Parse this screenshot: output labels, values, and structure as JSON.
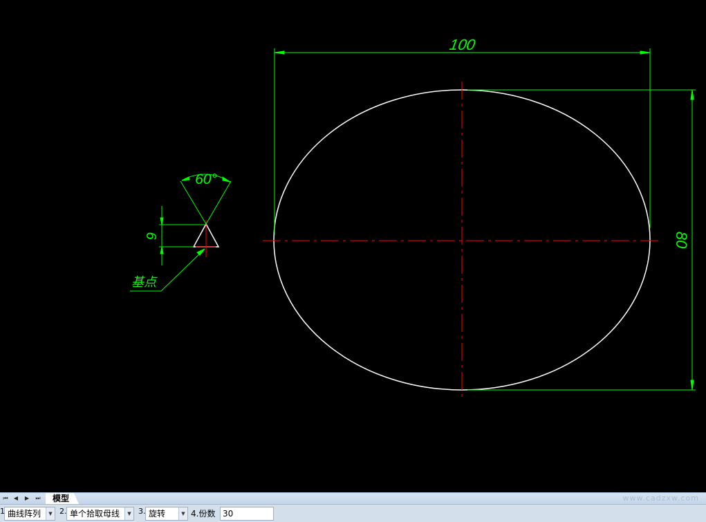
{
  "drawing": {
    "dim_width": "100",
    "dim_height": "80",
    "dim_angle": "60°",
    "dim_small": "6",
    "base_point_label": "基点",
    "colors": {
      "geometry": "#ffffff",
      "dimension": "#00ff00",
      "centerline": "#ff0000",
      "background": "#000000"
    }
  },
  "tabbar": {
    "nav": [
      "⏮",
      "◀",
      "▶",
      "⏭"
    ],
    "model_tab": "模型",
    "watermark": "www.cadzxw.com"
  },
  "props": {
    "f1_num": "1.",
    "f1_value": "曲线阵列",
    "f2_num": "2.",
    "f2_value": "单个拾取母线",
    "f3_num": "3.",
    "f3_value": "旋转",
    "f4_label": "4.份数",
    "f4_value": "30",
    "dropdown_icon": "▼"
  }
}
